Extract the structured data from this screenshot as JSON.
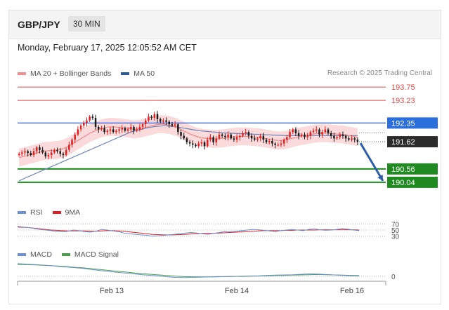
{
  "header": {
    "symbol": "GBP/JPY",
    "timeframe": "30 MIN"
  },
  "timestamp": "Monday, February 17, 2025 12:05:52 AM CET",
  "legend": {
    "items": [
      {
        "label": "MA 20 + Bollinger Bands",
        "color": "#f28b8b"
      },
      {
        "label": "MA 50",
        "color": "#2d5b9a"
      }
    ],
    "credit": "Research © 2025 Trading Central"
  },
  "colors": {
    "resistance": "#e24b4b",
    "pivot_line": "#2a5bd7",
    "pivot_bg": "#2a6fdb",
    "support": "#1a8a1a",
    "support_bg": "#1f8a1f",
    "last_price_bg": "#2b2b2b",
    "candle_up": "#e02020",
    "candle_down": "#1a1a1a",
    "band_fill": "#f9d3d3",
    "ma20": "#ee8a8a",
    "ma50": "#6d86b8",
    "arrow": "#2e5ea8"
  },
  "chart_data": [
    {
      "type": "candlestick",
      "title": "GBP/JPY",
      "timeframe": "30 MIN",
      "ylim": [
        189.9,
        194.0
      ],
      "x_ticks": [
        "Feb 13",
        "Feb 14",
        "Feb 16"
      ],
      "levels": [
        {
          "value": 193.75,
          "label": "193.75",
          "kind": "resistance"
        },
        {
          "value": 193.23,
          "label": "193.23",
          "kind": "resistance"
        },
        {
          "value": 192.35,
          "label": "192.35",
          "kind": "pivot"
        },
        {
          "value": 191.62,
          "label": "191.62",
          "kind": "last"
        },
        {
          "value": 190.56,
          "label": "190.56",
          "kind": "support"
        },
        {
          "value": 190.04,
          "label": "190.04",
          "kind": "support"
        }
      ],
      "closes": [
        191.15,
        191.2,
        191.25,
        191.18,
        191.1,
        191.25,
        191.4,
        191.3,
        191.2,
        191.05,
        191.1,
        191.2,
        191.3,
        191.25,
        191.15,
        191.1,
        191.3,
        191.5,
        191.7,
        191.9,
        192.1,
        192.25,
        192.35,
        192.45,
        192.6,
        192.55,
        192.2,
        192.1,
        192.15,
        192.0,
        192.05,
        192.1,
        192.0,
        192.05,
        192.1,
        192.15,
        192.05,
        192.1,
        192.2,
        192.05,
        192.1,
        192.2,
        192.3,
        192.45,
        192.6,
        192.55,
        192.7,
        192.5,
        192.4,
        192.45,
        192.4,
        192.3,
        192.25,
        192.3,
        192.0,
        191.85,
        191.75,
        191.6,
        191.55,
        191.5,
        191.45,
        191.55,
        191.6,
        191.45,
        191.7,
        191.8,
        191.6,
        191.75,
        191.9,
        191.85,
        191.8,
        191.9,
        191.75,
        191.7,
        191.8,
        191.85,
        191.95,
        192.0,
        191.85,
        191.75,
        191.7,
        191.75,
        191.85,
        191.7,
        191.6,
        191.65,
        191.55,
        191.5,
        191.5,
        191.55,
        191.7,
        191.8,
        192.0,
        192.1,
        191.95,
        191.85,
        191.9,
        191.8,
        191.85,
        192.0,
        192.05,
        192.1,
        191.9,
        192.0,
        192.1,
        191.95,
        191.85,
        191.75,
        191.8,
        191.9,
        191.85,
        191.75,
        191.7,
        191.75,
        191.7,
        191.62
      ],
      "ma20": [
        191.0,
        191.03,
        191.06,
        191.09,
        191.12,
        191.15,
        191.18,
        191.21,
        191.24,
        191.26,
        191.27,
        191.28,
        191.29,
        191.3,
        191.32,
        191.35,
        191.4,
        191.46,
        191.53,
        191.6,
        191.67,
        191.74,
        191.81,
        191.88,
        191.95,
        192.0,
        192.05,
        192.1,
        192.14,
        192.17,
        192.19,
        192.2,
        192.2,
        192.19,
        192.18,
        192.17,
        192.15,
        192.14,
        192.12,
        192.1,
        192.11,
        192.13,
        192.15,
        192.18,
        192.21,
        192.24,
        192.27,
        192.29,
        192.3,
        192.3,
        192.29,
        192.27,
        192.24,
        192.21,
        192.16,
        192.1,
        192.04,
        191.98,
        191.93,
        191.88,
        191.84,
        191.8,
        191.78,
        191.76,
        191.75,
        191.74,
        191.73,
        191.73,
        191.74,
        191.75,
        191.76,
        191.78,
        191.8,
        191.81,
        191.82,
        191.83,
        191.83,
        191.83,
        191.82,
        191.81,
        191.8,
        191.79,
        191.78,
        191.76,
        191.74,
        191.72,
        191.7,
        191.68,
        191.67,
        191.67,
        191.68,
        191.7,
        191.73,
        191.76,
        191.79,
        191.82,
        191.84,
        191.86,
        191.88,
        191.9,
        191.92,
        191.94,
        191.95,
        191.95,
        191.95,
        191.95,
        191.94,
        191.93,
        191.92,
        191.91,
        191.9,
        191.88,
        191.86,
        191.84,
        191.82,
        191.8
      ],
      "ma50": [
        190.1,
        190.15,
        190.2,
        190.25,
        190.3,
        190.35,
        190.4,
        190.45,
        190.5,
        190.55,
        190.6,
        190.65,
        190.7,
        190.75,
        190.8,
        190.85,
        190.9,
        190.95,
        191.0,
        191.05,
        191.1,
        191.15,
        191.2,
        191.25,
        191.3,
        191.35,
        191.4,
        191.45,
        191.5,
        191.55,
        191.6,
        191.65,
        191.7,
        191.75,
        191.8,
        191.85,
        191.9,
        191.95,
        192.0,
        192.03,
        192.06,
        192.09,
        192.12,
        192.15,
        192.17,
        192.19,
        192.21,
        192.22,
        192.23,
        192.24,
        192.24,
        192.23,
        192.22,
        192.21,
        192.19,
        192.17,
        192.15,
        192.13,
        192.11,
        192.09,
        192.07,
        192.05,
        192.04,
        192.03,
        192.02,
        192.01,
        192.0,
        191.99,
        191.98,
        191.97,
        191.96,
        191.96,
        191.95,
        191.95,
        191.94,
        191.94,
        191.93,
        191.93,
        191.92,
        191.92,
        191.91,
        191.91,
        191.9,
        191.9,
        191.89,
        191.89,
        191.88,
        191.88,
        191.87,
        191.87,
        191.86,
        191.86,
        191.86,
        191.86,
        191.86,
        191.86,
        191.86,
        191.86,
        191.86,
        191.86,
        191.86,
        191.86,
        191.86,
        191.86,
        191.86,
        191.86,
        191.86,
        191.86,
        191.86,
        191.86,
        191.86,
        191.86,
        191.86,
        191.86,
        191.86,
        191.86
      ],
      "forecast_arrow": {
        "from": 191.62,
        "to": 190.04
      }
    },
    {
      "type": "line",
      "series": [
        {
          "name": "RSI",
          "color": "#6b8fd6"
        },
        {
          "name": "9MA",
          "color": "#e02020"
        }
      ],
      "y_ticks": [
        "70",
        "50",
        "30"
      ],
      "levels": [
        70,
        50,
        30
      ],
      "ylim": [
        0,
        100
      ],
      "rsi": [
        62,
        60,
        58,
        55,
        52,
        50,
        48,
        45,
        44,
        46,
        50,
        48,
        45,
        43,
        46,
        52,
        50,
        47,
        45,
        40,
        38,
        36,
        34,
        33,
        30,
        31,
        32,
        34,
        36,
        38,
        40,
        42,
        40,
        38,
        36,
        39,
        42,
        45,
        44,
        46,
        48,
        50,
        52,
        51,
        49,
        47,
        45,
        48,
        50,
        52,
        50,
        48,
        52,
        54,
        51,
        49,
        50,
        52,
        55,
        53,
        50,
        48
      ],
      "ma9": [
        60,
        59,
        58,
        56,
        54,
        52,
        50,
        49,
        48,
        47,
        47,
        47,
        47,
        46,
        46,
        47,
        48,
        48,
        47,
        46,
        44,
        42,
        40,
        38,
        36,
        35,
        34,
        34,
        34,
        35,
        36,
        37,
        38,
        39,
        39,
        39,
        40,
        41,
        42,
        43,
        44,
        45,
        46,
        47,
        48,
        48,
        48,
        48,
        49,
        49,
        50,
        50,
        50,
        50,
        51,
        51,
        51,
        51,
        51,
        51,
        51,
        50
      ]
    },
    {
      "type": "line",
      "series": [
        {
          "name": "MACD",
          "color": "#6b8fd6"
        },
        {
          "name": "MACD Signal",
          "color": "#4aa04a"
        }
      ],
      "y_ticks": [
        "0"
      ],
      "macd": [
        0.62,
        0.6,
        0.58,
        0.55,
        0.52,
        0.48,
        0.45,
        0.42,
        0.38,
        0.33,
        0.28,
        0.24,
        0.2,
        0.16,
        0.12,
        0.08,
        0.05,
        0.02,
        -0.02,
        -0.05,
        -0.06,
        -0.05,
        -0.04,
        -0.03,
        -0.02,
        -0.01,
        0.0,
        0.01,
        0.02,
        0.03,
        0.05,
        0.06,
        0.07,
        0.08,
        0.1,
        0.12,
        0.11,
        0.09,
        0.07,
        0.05,
        0.03,
        0.02
      ],
      "signal": [
        0.58,
        0.57,
        0.56,
        0.54,
        0.52,
        0.5,
        0.47,
        0.44,
        0.41,
        0.37,
        0.33,
        0.29,
        0.25,
        0.21,
        0.17,
        0.13,
        0.1,
        0.07,
        0.04,
        0.01,
        -0.01,
        -0.02,
        -0.02,
        -0.02,
        -0.01,
        -0.01,
        0.0,
        0.0,
        0.01,
        0.02,
        0.03,
        0.04,
        0.05,
        0.06,
        0.07,
        0.08,
        0.09,
        0.08,
        0.07,
        0.06,
        0.05,
        0.04
      ]
    }
  ]
}
